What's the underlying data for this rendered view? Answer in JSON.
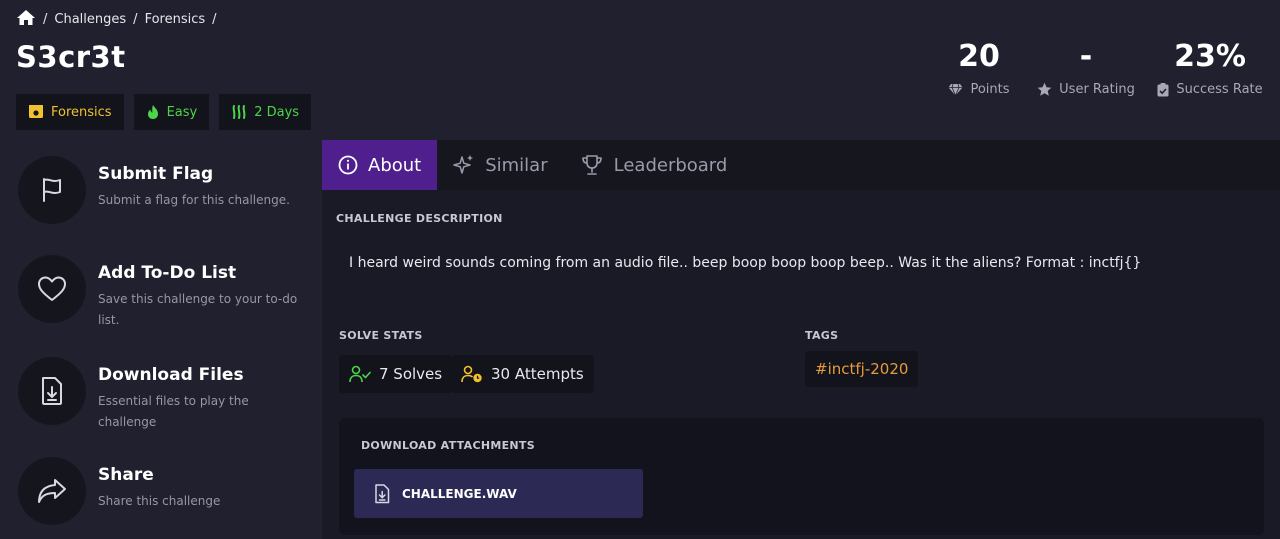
{
  "breadcrumb": {
    "items": [
      "Challenges",
      "Forensics"
    ],
    "separator": "/"
  },
  "challenge": {
    "title": "S3cr3t",
    "badges": {
      "category": "Forensics",
      "difficulty": "Easy",
      "age": "2 Days"
    }
  },
  "stats": {
    "points": {
      "value": "20",
      "label": "Points"
    },
    "rating": {
      "value": "-",
      "label": "User Rating"
    },
    "success": {
      "value": "23%",
      "label": "Success Rate"
    }
  },
  "actions": [
    {
      "title": "Submit Flag",
      "desc": "Submit a flag for this challenge."
    },
    {
      "title": "Add To-Do List",
      "desc": "Save this challenge to your to-do list."
    },
    {
      "title": "Download Files",
      "desc": "Essential files to play the challenge"
    },
    {
      "title": "Share",
      "desc": "Share this challenge"
    }
  ],
  "tabs": [
    {
      "label": "About",
      "active": true
    },
    {
      "label": "Similar",
      "active": false
    },
    {
      "label": "Leaderboard",
      "active": false
    }
  ],
  "about": {
    "description_label": "CHALLENGE DESCRIPTION",
    "description": "I heard weird sounds coming from an audio file.. beep boop boop boop beep.. Was it the aliens? Format : inctfj{}",
    "solve_stats_label": "SOLVE STATS",
    "solves": "7 Solves",
    "attempts": "30 Attempts",
    "tags_label": "TAGS",
    "tags": [
      "#inctfj-2020"
    ],
    "attachments_label": "DOWNLOAD ATTACHMENTS",
    "file_name": "CHALLENGE.WAV"
  },
  "colors": {
    "background": "#20202e",
    "active_tab": "#4f1f8e",
    "category": "#f2c12e",
    "easy": "#4ed44b",
    "tag": "#e59b3f",
    "file_button": "#2c2a55"
  }
}
